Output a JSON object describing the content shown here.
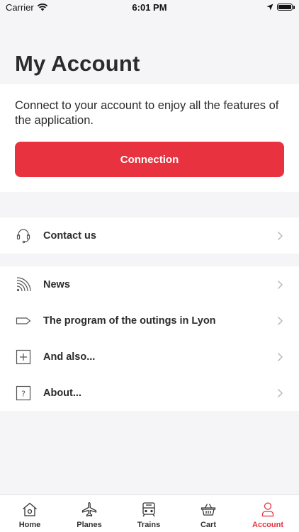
{
  "status_bar": {
    "carrier": "Carrier",
    "time": "6:01 PM"
  },
  "page": {
    "title": "My Account"
  },
  "connect": {
    "text": "Connect to your account to enjoy all the features of the application.",
    "button_label": "Connection"
  },
  "contact": {
    "label": "Contact us",
    "icon": "headset-icon"
  },
  "menu": [
    {
      "label": "News",
      "icon": "rss-icon"
    },
    {
      "label": "The program of the outings in Lyon",
      "icon": "tag-icon"
    },
    {
      "label": "And also...",
      "icon": "plus-square-icon"
    },
    {
      "label": "About...",
      "icon": "question-square-icon"
    }
  ],
  "tabs": [
    {
      "label": "Home",
      "icon": "home-icon",
      "active": false
    },
    {
      "label": "Planes",
      "icon": "plane-icon",
      "active": false
    },
    {
      "label": "Trains",
      "icon": "train-icon",
      "active": false
    },
    {
      "label": "Cart",
      "icon": "basket-icon",
      "active": false
    },
    {
      "label": "Account",
      "icon": "user-icon",
      "active": true
    }
  ],
  "colors": {
    "accent": "#e8323f",
    "background": "#f5f5f7",
    "card": "#ffffff",
    "text": "#2b2b2b"
  }
}
